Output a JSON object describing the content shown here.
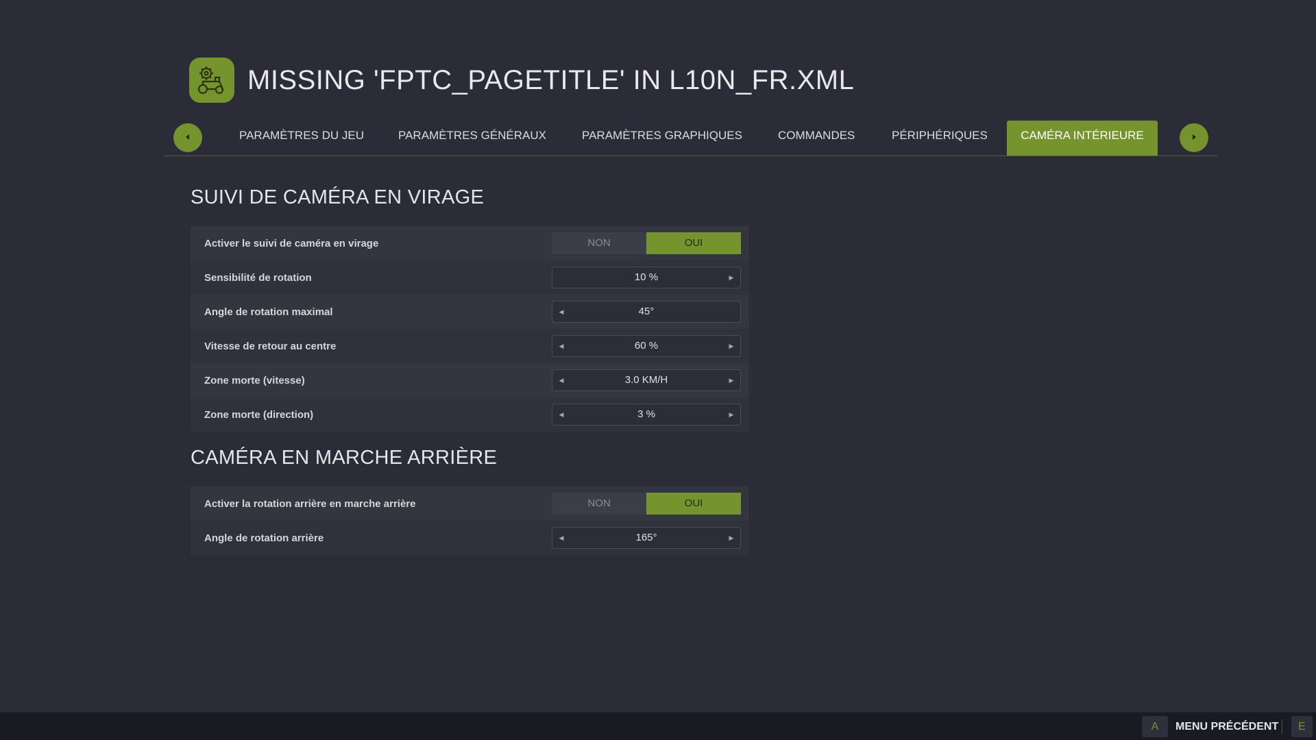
{
  "header": {
    "title": "MISSING 'FPTC_PAGETITLE' IN L10N_FR.XML",
    "logo_icon": "tractor-gear-icon"
  },
  "tabs": [
    {
      "label": "PARAMÈTRES DU JEU",
      "active": false
    },
    {
      "label": "PARAMÈTRES GÉNÉRAUX",
      "active": false
    },
    {
      "label": "PARAMÈTRES GRAPHIQUES",
      "active": false
    },
    {
      "label": "COMMANDES",
      "active": false
    },
    {
      "label": "PÉRIPHÉRIQUES",
      "active": false
    },
    {
      "label": "CAMÉRA INTÉRIEURE",
      "active": true
    }
  ],
  "sections": [
    {
      "title": "SUIVI DE CAMÉRA EN VIRAGE",
      "rows": [
        {
          "label": "Activer le suivi de caméra en virage",
          "type": "toggle",
          "off": "NON",
          "on": "OUI",
          "value": "OUI"
        },
        {
          "label": "Sensibilité de rotation",
          "type": "stepper",
          "value": "10 %",
          "left_arrow": false,
          "right_arrow": true
        },
        {
          "label": "Angle de rotation maximal",
          "type": "stepper",
          "value": "45°",
          "left_arrow": true,
          "right_arrow": false
        },
        {
          "label": "Vitesse de retour au centre",
          "type": "stepper",
          "value": "60 %",
          "left_arrow": true,
          "right_arrow": true
        },
        {
          "label": "Zone morte (vitesse)",
          "type": "stepper",
          "value": "3.0 KM/H",
          "left_arrow": true,
          "right_arrow": true
        },
        {
          "label": "Zone morte (direction)",
          "type": "stepper",
          "value": "3 %",
          "left_arrow": true,
          "right_arrow": true
        }
      ]
    },
    {
      "title": "CAMÉRA EN MARCHE ARRIÈRE",
      "rows": [
        {
          "label": "Activer la rotation arrière en marche arrière",
          "type": "toggle",
          "off": "NON",
          "on": "OUI",
          "value": "OUI"
        },
        {
          "label": "Angle de rotation arrière",
          "type": "stepper",
          "value": "165°",
          "left_arrow": true,
          "right_arrow": true
        }
      ]
    }
  ],
  "footer": {
    "back_key": "A",
    "back_label": "MENU PRÉCÉDENT",
    "next_key": "E"
  },
  "colors": {
    "accent": "#76942d",
    "background": "#2b2c37",
    "footer": "#191a22"
  }
}
